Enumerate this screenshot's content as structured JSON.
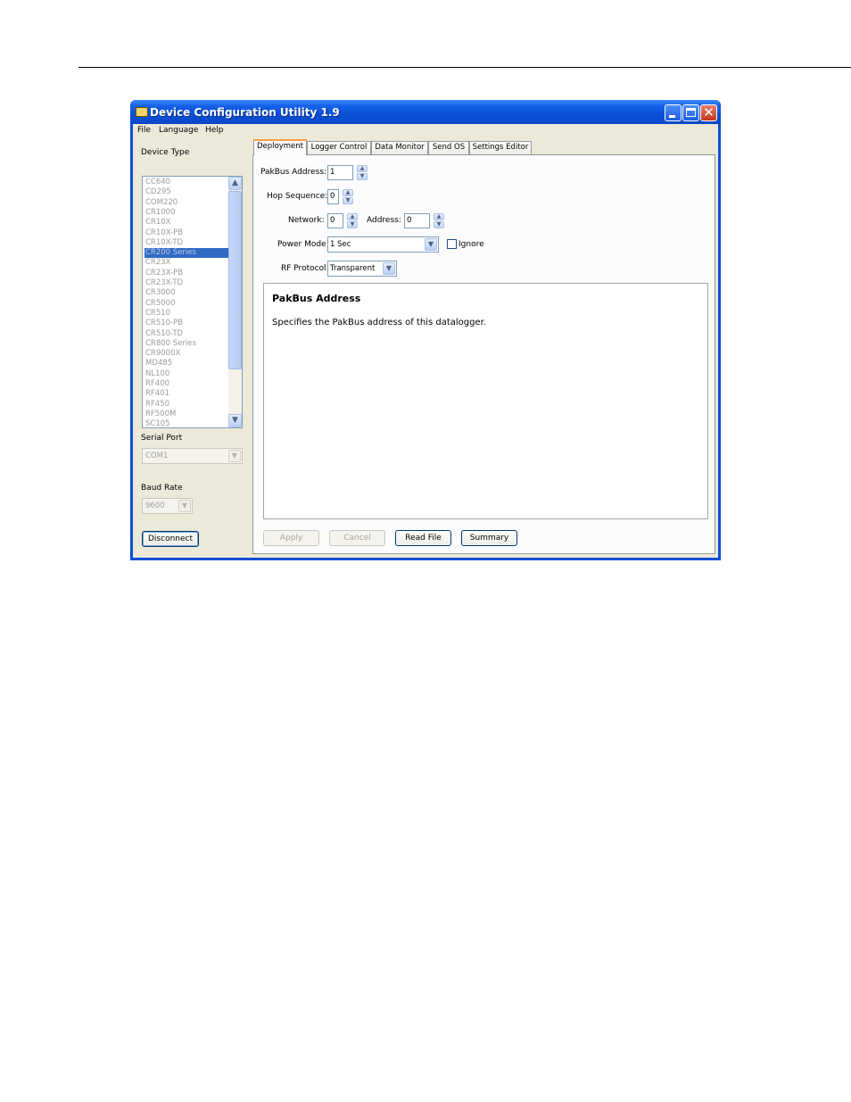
{
  "window": {
    "title": "Device Configuration Utility 1.9",
    "accent": "#0a4fd6",
    "controls": {
      "minimize": "_",
      "maximize": "□",
      "close": "✕"
    }
  },
  "menu": [
    {
      "label": "File"
    },
    {
      "label": "Language"
    },
    {
      "label": "Help"
    }
  ],
  "left": {
    "device_type_label": "Device Type",
    "devices": [
      "CC640",
      "CD295",
      "COM220",
      "CR1000",
      "CR10X",
      "CR10X-PB",
      "CR10X-TD",
      "CR200 Series",
      "CR23X",
      "CR23X-PB",
      "CR23X-TD",
      "CR3000",
      "CR5000",
      "CR510",
      "CR510-PB",
      "CR510-TD",
      "CR800 Series",
      "CR9000X",
      "MD485",
      "NL100",
      "RF400",
      "RF401",
      "RF450",
      "RF500M",
      "SC105"
    ],
    "selected_device": "CR200 Series",
    "serial_port_label": "Serial Port",
    "serial_port_value": "COM1",
    "baud_rate_label": "Baud Rate",
    "baud_rate_value": "9600",
    "disconnect_label": "Disconnect"
  },
  "tabs": [
    "Deployment",
    "Logger Control",
    "Data Monitor",
    "Send OS",
    "Settings Editor"
  ],
  "active_tab": "Deployment",
  "deployment": {
    "pakbus_label": "PakBus Address:",
    "pakbus_value": "1",
    "hop_label": "Hop Sequence:",
    "hop_value": "0",
    "network_label": "Network:",
    "network_value": "0",
    "address_label": "Address:",
    "address_value": "0",
    "power_label": "Power Mode",
    "power_value": "1 Sec",
    "ignore_label": "Ignore",
    "ignore_checked": false,
    "rf_label": "RF Protocol",
    "rf_value": "Transparent",
    "help_title": "PakBus Address",
    "help_text": "Specifies the PakBus address of this datalogger."
  },
  "buttons": {
    "apply": "Apply",
    "cancel": "Cancel",
    "read_file": "Read File",
    "summary": "Summary"
  }
}
